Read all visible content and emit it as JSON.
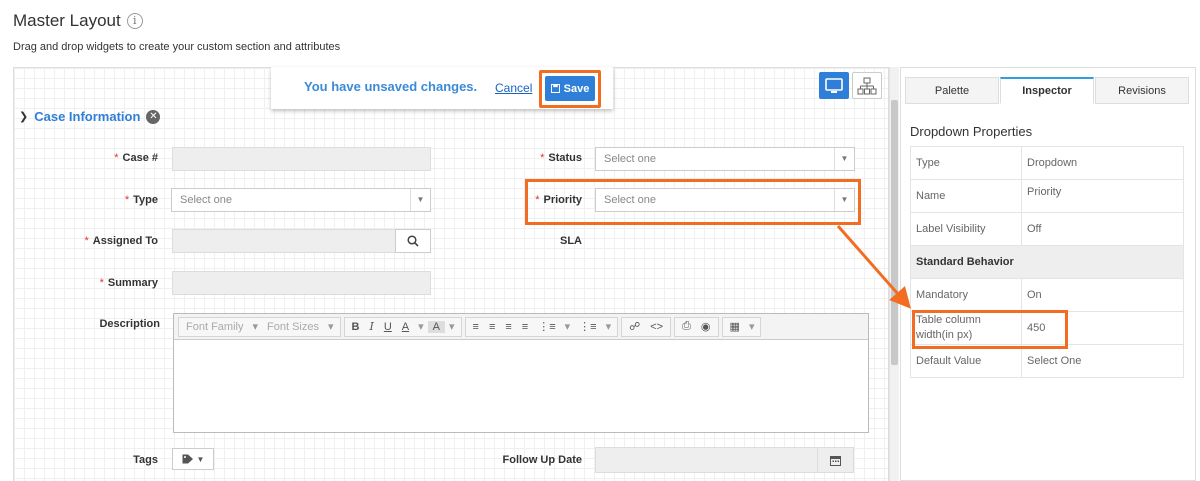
{
  "page": {
    "title": "Master Layout",
    "subtitle": "Drag and drop widgets to create your custom section and attributes"
  },
  "notice": {
    "text": "You have unsaved changes.",
    "cancel_label": "Cancel",
    "save_label": "Save"
  },
  "section": {
    "title": "Case Information"
  },
  "fields": {
    "case_no": "Case #",
    "status": "Status",
    "status_placeholder": "Select one",
    "type": "Type",
    "type_placeholder": "Select one",
    "priority": "Priority",
    "priority_placeholder": "Select one",
    "assigned_to": "Assigned To",
    "sla": "SLA",
    "summary": "Summary",
    "description": "Description",
    "tags": "Tags",
    "follow_up": "Follow Up Date",
    "required_mark": "*"
  },
  "editor": {
    "font_family": "Font Family",
    "font_sizes": "Font Sizes",
    "bold": "B",
    "italic": "I",
    "underline": "U",
    "text_color": "A",
    "bg_color": "A"
  },
  "panel": {
    "tabs": [
      "Palette",
      "Inspector",
      "Revisions"
    ],
    "heading": "Dropdown Properties",
    "props": [
      {
        "k": "Type",
        "v": "Dropdown"
      },
      {
        "k": "Name",
        "v": "Priority"
      },
      {
        "k": "Label Visibility",
        "v": "Off"
      },
      {
        "k": "Standard Behavior",
        "v": ""
      },
      {
        "k": "Mandatory",
        "v": "On"
      },
      {
        "k": "Table column width(in px)",
        "v": "450"
      },
      {
        "k": "Default Value",
        "v": "Select One"
      }
    ]
  },
  "colors": {
    "accent": "#2f7fd8",
    "highlight": "#f26d21",
    "required": "#dd3333"
  }
}
